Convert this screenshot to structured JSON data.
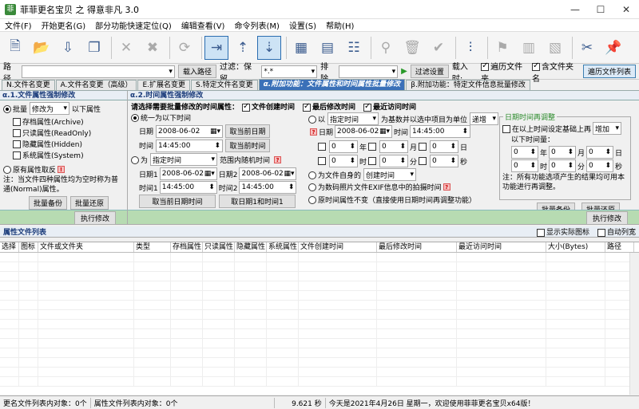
{
  "window": {
    "title": "菲菲更名宝贝 之 得意非凡 3.0"
  },
  "menu": [
    "文件(F)",
    "开始更名(G)",
    "部分功能快速定位(Q)",
    "编辑查看(V)",
    "命令列表(M)",
    "设置(S)",
    "帮助(H)"
  ],
  "pathbar": {
    "path_label": "路径",
    "load_path": "载入路径",
    "filter_label": "过滤：保留",
    "filter_value": "*.*",
    "exclude_label": "排除",
    "filter_settings": "过滤设置",
    "load_label": "载入时:",
    "traverse_folders": "遍历文件夹",
    "include_folder_name": "含文件夹名",
    "traverse_list": "遍历文件列表"
  },
  "tabs": [
    "N.文件名变更",
    "A.文件名变更（高级）",
    "E.扩展名变更",
    "S.特定文件名变更",
    "α.附加功能：文件属性和时间属性批量修改",
    "β.附加功能：特定文件信息批量修改"
  ],
  "left_panel": {
    "title": "α.1.文件属性强制修改",
    "batch": "批量",
    "batch_mode": "修改为",
    "batch_suffix": "以下属性",
    "attrs": [
      "存档属性(Archive)",
      "只读属性(ReadOnly)",
      "隐藏属性(Hidden)",
      "系统属性(System)"
    ],
    "invert": "原有属性取反",
    "note": "注：当文件四种属性均为空时称为普通(Normal)属性。",
    "backup": "批量备份",
    "restore": "批量还原",
    "execute": "执行修改"
  },
  "right_panel": {
    "title": "α.2.时间属性强制修改",
    "select_label": "请选择需要批量修改的时间属性：",
    "create_time": "文件创建时间",
    "modify_time": "最后修改时间",
    "access_time": "最近访问时间",
    "uniform": "统一为以下时间",
    "date_label": "日期",
    "time_label": "时间",
    "date_value": "2008-06-02",
    "time_value": "14:45:00",
    "take_current_date": "取当前日期",
    "take_current_time": "取当前时间",
    "random_for": "为",
    "random_mode": "指定时间",
    "random_range": "范围内随机时间",
    "date1": "日期1",
    "date2": "日期2",
    "time1": "时间1",
    "time2": "时间2",
    "take_date12": "取当前日期时间",
    "take_time12": "取日期1和时间1",
    "by_label": "以",
    "by_mode": "指定时间",
    "by_base": "为基数并以选中项目为单位",
    "by_op": "递增",
    "year": "年",
    "month": "月",
    "day": "日",
    "hour": "时",
    "minute": "分",
    "second": "秒",
    "zero": "0",
    "self_for": "为文件自身的",
    "self_mode": "创建时间",
    "exif": "为数码照片文件EXIF信息中的拍摄时间",
    "keep_original": "原时间属性不变（直接使用日期时间再调整功能）",
    "readjust_title": "日期时间再调整",
    "readjust_check": "在以上时间设定基础上再",
    "readjust_op": "增加",
    "readjust_amount": "以下时间量：",
    "readjust_note": "注：所有功能选项产生的结果均可用本功能进行再调整。",
    "backup": "批量备份",
    "restore": "批量还原",
    "execute": "执行修改"
  },
  "list": {
    "title": "属性文件列表",
    "show_icons": "显示实际图标",
    "auto_columns": "自动列宽",
    "columns": [
      "选择",
      "图标",
      "文件或文件夹",
      "类型",
      "存档属性",
      "只读属性",
      "隐藏属性",
      "系统属性",
      "文件创建时间",
      "最后修改时间",
      "最近访问时间",
      "大小(Bytes)",
      "路径"
    ]
  },
  "status": {
    "rename_count": "更名文件列表内对象：0个",
    "attr_count": "属性文件列表内对象：0个",
    "timing": "9.621 秒",
    "message": "今天是2021年4月26日 星期一，欢迎使用菲菲更名宝贝x64版！"
  }
}
